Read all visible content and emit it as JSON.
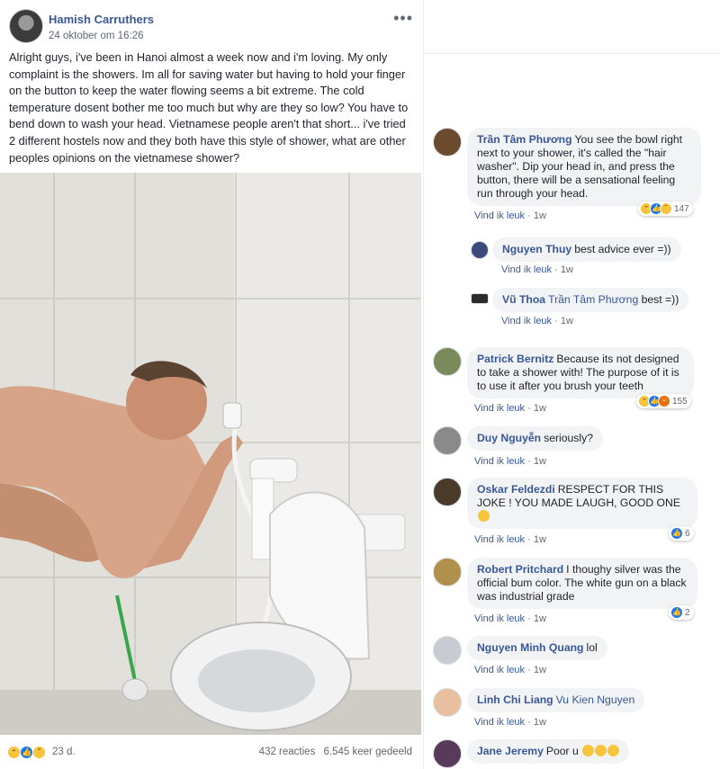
{
  "post": {
    "author": "Hamish Carruthers",
    "date": "24 oktober om 16:26",
    "more_label": "•••",
    "text": "Alright guys, i've been in Hanoi almost a week now and i'm loving. My only complaint is the showers. Im all for saving water but having to hold your finger on the button to keep the water flowing seems a bit extreme. The cold temperature dosent bother me too much but why are they so low? You have to bend down to wash your head. Vietnamese people aren't that short... i've tried 2 different hostels now and they both have this style of shower, what are other peoples opinions on the vietnamese shower?",
    "footer": {
      "reactions": [
        "haha",
        "like",
        "sad"
      ],
      "reaction_time": "23 d.",
      "reacties": "432 reacties",
      "shares": "6.545 keer gedeeld"
    }
  },
  "comments": [
    {
      "name": "Trần Tâm Phương",
      "text": "You see the bowl right next to your shower, it's called the \"hair washer\". Dip your head in, and press the button, there will be a sensational feeling run through your head.",
      "like_label": "Vind ik leuk",
      "time": "1w",
      "reactions": [
        "haha",
        "like",
        "sad"
      ],
      "reaction_count": "147",
      "avatar_color": "#6b4a2e"
    },
    {
      "name": "Nguyen Thuy",
      "text": "best advice ever =))",
      "like_label": "Vind ik leuk",
      "time": "1w",
      "avatar_color": "#3b4a7a"
    },
    {
      "name": "Vũ Thoa",
      "tag": "Trần Tâm Phương",
      "text": "best =))",
      "like_label": "Vind ik leuk",
      "time": "1w",
      "avatar_color": "#2b2b2b"
    },
    {
      "name": "Patrick Bernitz",
      "text": "Because its not designed to take a shower with! The purpose of it is to use it after you brush your teeth",
      "like_label": "Vind ik leuk",
      "time": "1w",
      "reactions": [
        "haha",
        "like",
        "angry"
      ],
      "reaction_count": "155",
      "avatar_color": "#7a8a5a"
    },
    {
      "name": "Duy Nguyễn",
      "text": "seriously?",
      "like_label": "Vind ik leuk",
      "time": "1w",
      "avatar_color": "#8a8a8a"
    },
    {
      "name": "Oskar Feldezdi",
      "text": "RESPECT FOR THIS JOKE ! YOU MADE LAUGH, GOOD ONE",
      "like_label": "Vind ik leuk",
      "time": "1w",
      "reactions": [
        "like"
      ],
      "reaction_count": "6",
      "avatar_color": "#4a3a2a"
    },
    {
      "name": "Robert Pritchard",
      "text": "I thoughy silver was the official bum color. The white gun on a black was industrial grade",
      "like_label": "Vind ik leuk",
      "time": "1w",
      "reactions": [
        "like"
      ],
      "reaction_count": "2",
      "avatar_color": "#b0904a"
    },
    {
      "name": "Nguyen Minh Quang",
      "text": "lol",
      "like_label": "Vind ik leuk",
      "time": "1w",
      "avatar_color": "#c8ccd2"
    },
    {
      "name": "Linh Chi Liang",
      "tag": "Vu Kien Nguyen",
      "text": "",
      "like_label": "Vind ik leuk",
      "time": "1w",
      "avatar_color": "#e8c0a0"
    },
    {
      "name": "Jane Jeremy",
      "text": "Poor u",
      "avatar_color": "#5a3a5a"
    }
  ],
  "colors": {
    "link_blue": "#385898",
    "bubble_bg": "#f2f3f5",
    "meta_gray": "#606770"
  }
}
